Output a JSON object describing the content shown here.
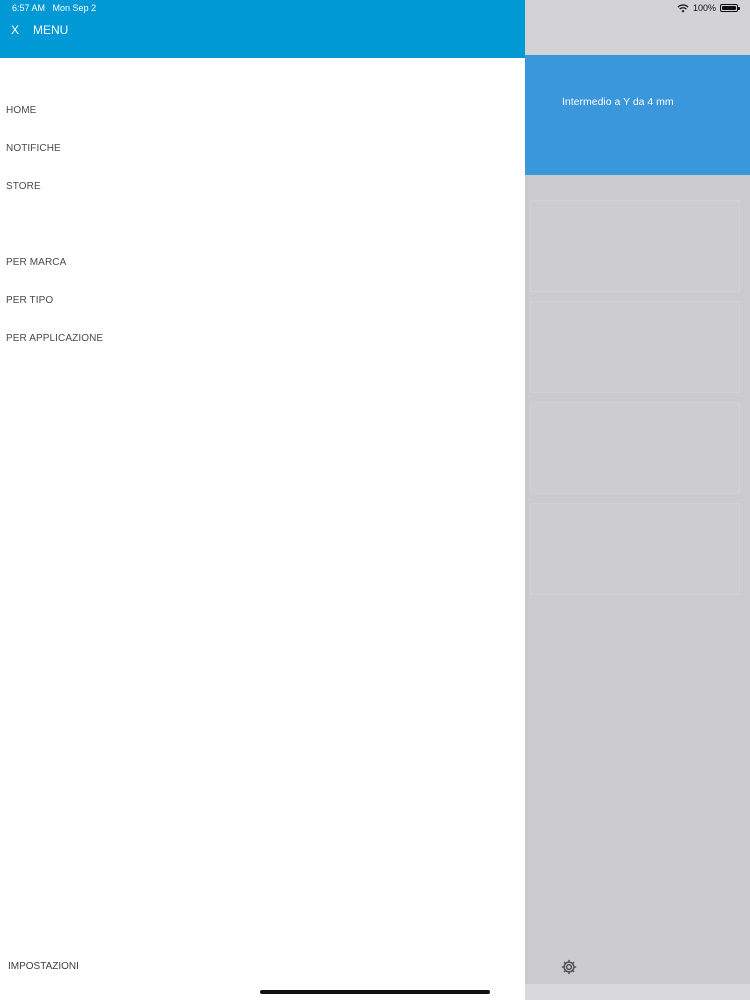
{
  "status_bar": {
    "time": "6:57 AM",
    "date": "Mon Sep 2",
    "battery": "100%",
    "icons": [
      "wifi-icon",
      "battery-icon"
    ]
  },
  "drawer": {
    "close_label": "X",
    "title": "MENU",
    "items": [
      {
        "label": "HOME"
      },
      {
        "label": "NOTIFICHE"
      },
      {
        "label": "STORE"
      },
      {
        "label": "PER MARCA"
      },
      {
        "label": "PER TIPO"
      },
      {
        "label": "PER APPLICAZIONE"
      }
    ],
    "settings_label": "IMPOSTAZIONI",
    "colors": {
      "header": "#0099d6"
    }
  },
  "background_app": {
    "banner_text": "Intermedio a Y da 4 mm",
    "footer_icon": "gear-icon",
    "colors": {
      "banner": "#3a97dc"
    }
  }
}
